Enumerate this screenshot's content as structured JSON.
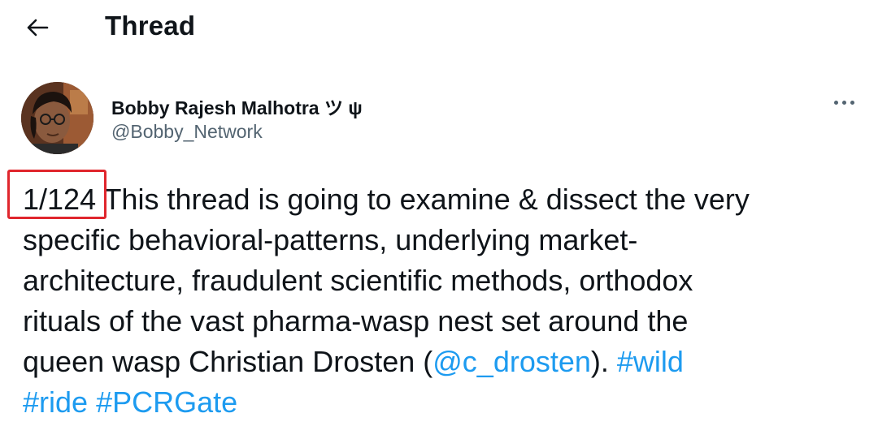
{
  "header": {
    "back_icon": "back-arrow-icon",
    "title": "Thread"
  },
  "tweet": {
    "author": {
      "display_name": "Bobby Rajesh Malhotra ツ ψ",
      "handle": "@Bobby_Network",
      "avatar": "profile-photo"
    },
    "more_icon": "more-dots-icon",
    "counter": "1/124",
    "text": {
      "line1_rest": " This thread is going to examine & dissect the very",
      "line2": "specific behavioral-patterns, underlying market-",
      "line3": "architecture, fraudulent scientific methods, orthodox",
      "line4": "rituals of the vast pharma-wasp nest set around the",
      "line5_before_mention": "queen wasp Christian Drosten (",
      "mention": "@c_drosten",
      "line5_after_mention": "). ",
      "hashtag_wild": "#wild",
      "hashtag_ride": "#ride",
      "hashtag_space": " ",
      "hashtag_pcrgate": "#PCRGate"
    },
    "annotation_color": "#e0262d",
    "link_color": "#1d9bf0"
  }
}
